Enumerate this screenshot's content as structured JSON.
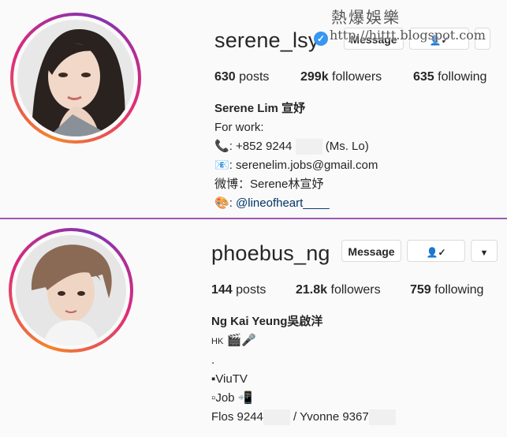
{
  "watermark": {
    "title": "熱爆娛樂",
    "url": "http://hittt.blogspot.com"
  },
  "profile1": {
    "username": "serene_lsy",
    "message_label": "Message",
    "posts_num": "630",
    "posts_label": "posts",
    "followers_num": "299k",
    "followers_label": "followers",
    "following_num": "635",
    "following_label": "following",
    "name": "Serene Lim 宣妤",
    "line_work": "For work:",
    "phone": ": +852 9244",
    "phone_suffix": "(Ms. Lo)",
    "email": ": serenelim.jobs@gmail.com",
    "weibo": "微博：Serene林宣妤",
    "mention_prefix": ":",
    "mention": "@lineofheart____"
  },
  "profile2": {
    "username": "phoebus_ng",
    "message_label": "Message",
    "posts_num": "144",
    "posts_label": "posts",
    "followers_num": "21.8k",
    "followers_label": "followers",
    "following_num": "759",
    "following_label": "following",
    "name": "Ng Kai Yeung吳啟洋",
    "line1": "HK",
    "line2": ".",
    "line3": "▪ViuTV",
    "line4": "▫Job",
    "contacts": "Flos 9244",
    "contacts2": "/ Yvonne 9367"
  }
}
